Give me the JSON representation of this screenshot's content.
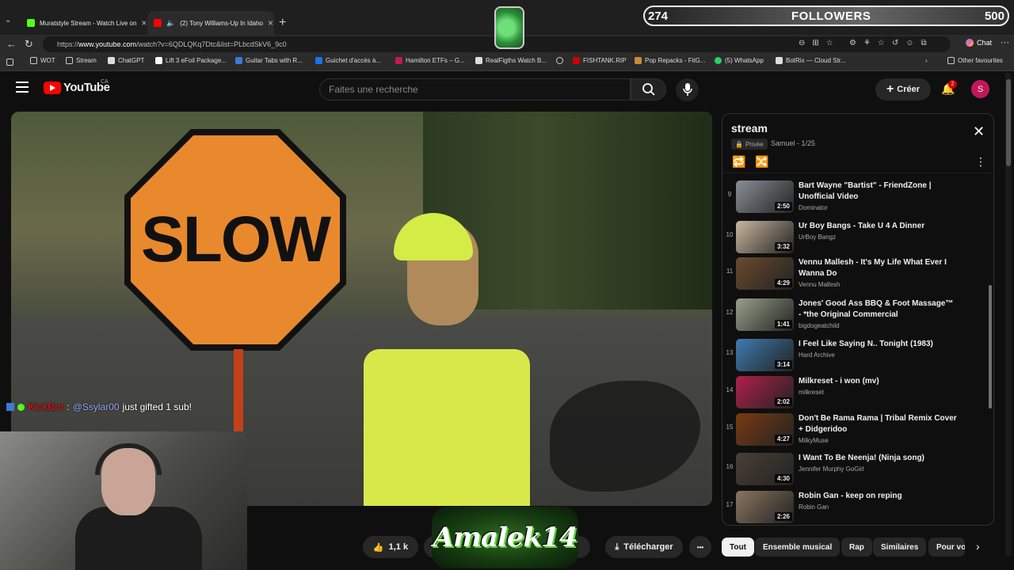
{
  "browser": {
    "tabs": [
      {
        "title": "Muratstyle Stream - Watch Live on",
        "favicon_color": "#53fc18"
      },
      {
        "title": "(2) Tony Williams-Up In Idaho",
        "favicon_color": "#ff0000"
      }
    ],
    "url_prefix": "https://",
    "url_host": "www.youtube.com",
    "url_rest": "/watch?v=6QDLQKq7Dtc&list=PLbcdSkV6_9c0",
    "chat_label": "Chat",
    "bookmarks": [
      "WOT",
      "Stream",
      "ChatGPT",
      "Lift 3 eFoil Package...",
      "Guitar Tabs with R...",
      "Guichet d'accès à...",
      "Hamilton ETFs – G...",
      "RealFigths Watch B...",
      "",
      "FISHTANK.RIP",
      "Pop Repacks - FitG...",
      "(5) WhatsApp",
      "BotRix — Cloud Str..."
    ],
    "other_favourites": "Other favourites"
  },
  "overlay": {
    "followers_current": "274",
    "followers_label": "FOLLOWERS",
    "followers_goal": "500",
    "chat": {
      "user": "KickBot",
      "mention": "@Ssylar00",
      "message": "just gifted 1 sub!"
    },
    "logo_text": "Amalek14"
  },
  "youtube": {
    "logo": "YouTube",
    "country": "CA",
    "search_placeholder": "Faites une recherche",
    "create_label": "Créer",
    "notifications": "2",
    "avatar_letter": "S",
    "video_sign_text": "SLOW",
    "likes": "1,1 k",
    "share_label": "rtager",
    "download_label": "Télécharger",
    "more": "•••",
    "chips": [
      "Tout",
      "Ensemble musical",
      "Rap",
      "Similaires",
      "Pour vo"
    ]
  },
  "playlist": {
    "title": "stream",
    "privacy": "Privée",
    "meta": "Samuel - 1/25",
    "items": [
      {
        "num": "9",
        "title": "Bart Wayne \"Bartist\" - FriendZone | Unofficial Video",
        "channel": "Dominator",
        "duration": "2:50",
        "thumb": "#8a8f96"
      },
      {
        "num": "10",
        "title": "Ur Boy Bangs - Take U 4 A Dinner",
        "channel": "UrBoy Bangz",
        "duration": "3:32",
        "thumb": "#c9b7a0"
      },
      {
        "num": "11",
        "title": "Vennu Mallesh - It's My Life What Ever I Wanna Do",
        "channel": "Vennu Mallesh",
        "duration": "4:29",
        "thumb": "#6b4a2e"
      },
      {
        "num": "12",
        "title": "Jones' Good Ass BBQ & Foot Massage™ - *the Original Commercial",
        "channel": "bigdogeatchild",
        "duration": "1:41",
        "thumb": "#9aa08a"
      },
      {
        "num": "13",
        "title": "I Feel Like Saying N.. Tonight (1983)",
        "channel": "Hard Archive",
        "duration": "3:14",
        "thumb": "#3f7bb0"
      },
      {
        "num": "14",
        "title": "Milkreset - i won (mv)",
        "channel": "milkreset",
        "duration": "2:02",
        "thumb": "#b0204a"
      },
      {
        "num": "15",
        "title": "Don't Be Rama Rama | Tribal Remix Cover + Didgeridoo",
        "channel": "MilkyMuse",
        "duration": "4:27",
        "thumb": "#7a3a12"
      },
      {
        "num": "16",
        "title": "I Want To Be Neenja! (Ninja song)",
        "channel": "Jennifer Murphy GoGirl",
        "duration": "4:30",
        "thumb": "#4a4036"
      },
      {
        "num": "17",
        "title": "Robin Gan - keep on reping",
        "channel": "Robin Gan",
        "duration": "2:26",
        "thumb": "#8a7560"
      }
    ]
  }
}
